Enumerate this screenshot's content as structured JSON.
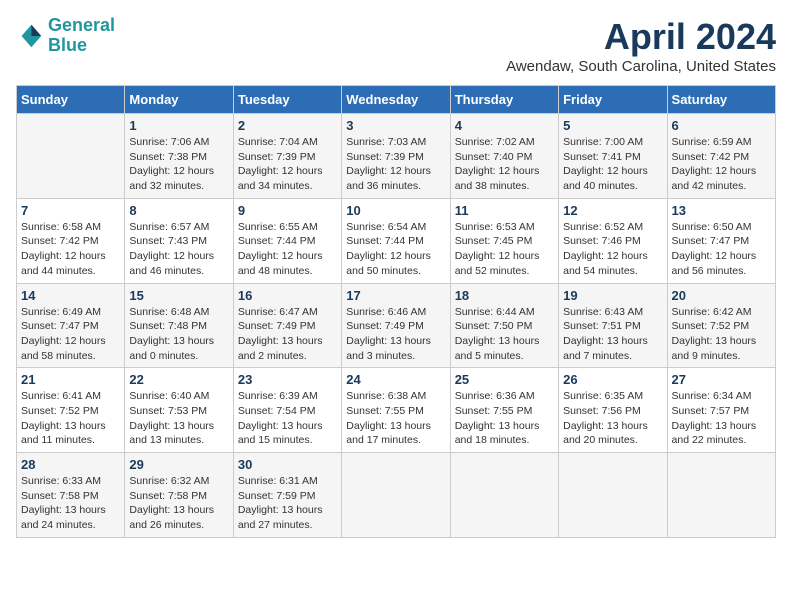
{
  "header": {
    "logo_line1": "General",
    "logo_line2": "Blue",
    "month_title": "April 2024",
    "location": "Awendaw, South Carolina, United States"
  },
  "days_of_week": [
    "Sunday",
    "Monday",
    "Tuesday",
    "Wednesday",
    "Thursday",
    "Friday",
    "Saturday"
  ],
  "weeks": [
    [
      {
        "num": "",
        "info": ""
      },
      {
        "num": "1",
        "info": "Sunrise: 7:06 AM\nSunset: 7:38 PM\nDaylight: 12 hours\nand 32 minutes."
      },
      {
        "num": "2",
        "info": "Sunrise: 7:04 AM\nSunset: 7:39 PM\nDaylight: 12 hours\nand 34 minutes."
      },
      {
        "num": "3",
        "info": "Sunrise: 7:03 AM\nSunset: 7:39 PM\nDaylight: 12 hours\nand 36 minutes."
      },
      {
        "num": "4",
        "info": "Sunrise: 7:02 AM\nSunset: 7:40 PM\nDaylight: 12 hours\nand 38 minutes."
      },
      {
        "num": "5",
        "info": "Sunrise: 7:00 AM\nSunset: 7:41 PM\nDaylight: 12 hours\nand 40 minutes."
      },
      {
        "num": "6",
        "info": "Sunrise: 6:59 AM\nSunset: 7:42 PM\nDaylight: 12 hours\nand 42 minutes."
      }
    ],
    [
      {
        "num": "7",
        "info": "Sunrise: 6:58 AM\nSunset: 7:42 PM\nDaylight: 12 hours\nand 44 minutes."
      },
      {
        "num": "8",
        "info": "Sunrise: 6:57 AM\nSunset: 7:43 PM\nDaylight: 12 hours\nand 46 minutes."
      },
      {
        "num": "9",
        "info": "Sunrise: 6:55 AM\nSunset: 7:44 PM\nDaylight: 12 hours\nand 48 minutes."
      },
      {
        "num": "10",
        "info": "Sunrise: 6:54 AM\nSunset: 7:44 PM\nDaylight: 12 hours\nand 50 minutes."
      },
      {
        "num": "11",
        "info": "Sunrise: 6:53 AM\nSunset: 7:45 PM\nDaylight: 12 hours\nand 52 minutes."
      },
      {
        "num": "12",
        "info": "Sunrise: 6:52 AM\nSunset: 7:46 PM\nDaylight: 12 hours\nand 54 minutes."
      },
      {
        "num": "13",
        "info": "Sunrise: 6:50 AM\nSunset: 7:47 PM\nDaylight: 12 hours\nand 56 minutes."
      }
    ],
    [
      {
        "num": "14",
        "info": "Sunrise: 6:49 AM\nSunset: 7:47 PM\nDaylight: 12 hours\nand 58 minutes."
      },
      {
        "num": "15",
        "info": "Sunrise: 6:48 AM\nSunset: 7:48 PM\nDaylight: 13 hours\nand 0 minutes."
      },
      {
        "num": "16",
        "info": "Sunrise: 6:47 AM\nSunset: 7:49 PM\nDaylight: 13 hours\nand 2 minutes."
      },
      {
        "num": "17",
        "info": "Sunrise: 6:46 AM\nSunset: 7:49 PM\nDaylight: 13 hours\nand 3 minutes."
      },
      {
        "num": "18",
        "info": "Sunrise: 6:44 AM\nSunset: 7:50 PM\nDaylight: 13 hours\nand 5 minutes."
      },
      {
        "num": "19",
        "info": "Sunrise: 6:43 AM\nSunset: 7:51 PM\nDaylight: 13 hours\nand 7 minutes."
      },
      {
        "num": "20",
        "info": "Sunrise: 6:42 AM\nSunset: 7:52 PM\nDaylight: 13 hours\nand 9 minutes."
      }
    ],
    [
      {
        "num": "21",
        "info": "Sunrise: 6:41 AM\nSunset: 7:52 PM\nDaylight: 13 hours\nand 11 minutes."
      },
      {
        "num": "22",
        "info": "Sunrise: 6:40 AM\nSunset: 7:53 PM\nDaylight: 13 hours\nand 13 minutes."
      },
      {
        "num": "23",
        "info": "Sunrise: 6:39 AM\nSunset: 7:54 PM\nDaylight: 13 hours\nand 15 minutes."
      },
      {
        "num": "24",
        "info": "Sunrise: 6:38 AM\nSunset: 7:55 PM\nDaylight: 13 hours\nand 17 minutes."
      },
      {
        "num": "25",
        "info": "Sunrise: 6:36 AM\nSunset: 7:55 PM\nDaylight: 13 hours\nand 18 minutes."
      },
      {
        "num": "26",
        "info": "Sunrise: 6:35 AM\nSunset: 7:56 PM\nDaylight: 13 hours\nand 20 minutes."
      },
      {
        "num": "27",
        "info": "Sunrise: 6:34 AM\nSunset: 7:57 PM\nDaylight: 13 hours\nand 22 minutes."
      }
    ],
    [
      {
        "num": "28",
        "info": "Sunrise: 6:33 AM\nSunset: 7:58 PM\nDaylight: 13 hours\nand 24 minutes."
      },
      {
        "num": "29",
        "info": "Sunrise: 6:32 AM\nSunset: 7:58 PM\nDaylight: 13 hours\nand 26 minutes."
      },
      {
        "num": "30",
        "info": "Sunrise: 6:31 AM\nSunset: 7:59 PM\nDaylight: 13 hours\nand 27 minutes."
      },
      {
        "num": "",
        "info": ""
      },
      {
        "num": "",
        "info": ""
      },
      {
        "num": "",
        "info": ""
      },
      {
        "num": "",
        "info": ""
      }
    ]
  ]
}
